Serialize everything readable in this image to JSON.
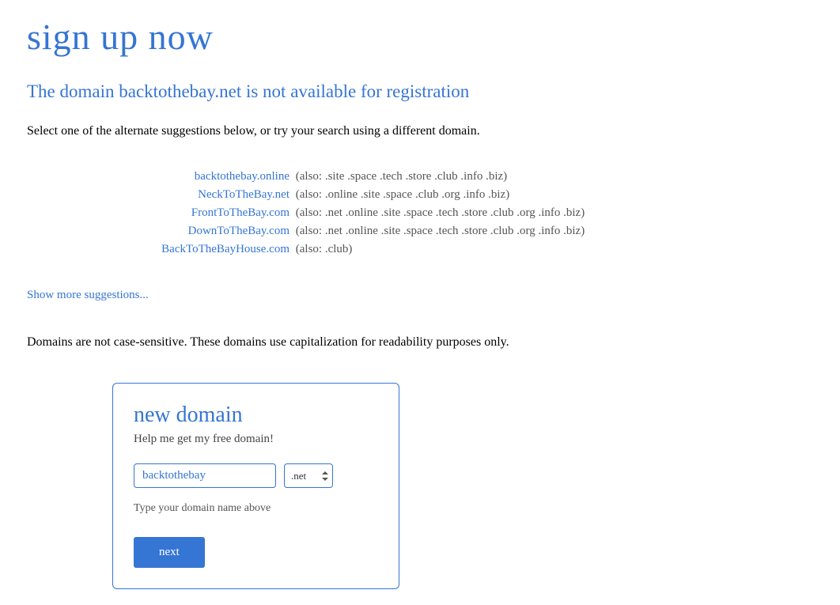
{
  "header": {
    "title": "sign up now",
    "subtitle": "The domain backtothebay.net is not available for registration",
    "instruction": "Select one of the alternate suggestions below, or try your search using a different domain."
  },
  "suggestions": [
    {
      "domain": "backtothebay.online",
      "also": "(also: .site .space .tech .store .club .info .biz)"
    },
    {
      "domain": "NeckToTheBay.net",
      "also": "(also: .online .site .space .club .org .info .biz)"
    },
    {
      "domain": "FrontToTheBay.com",
      "also": "(also: .net .online .site .space .tech .store .club .org .info .biz)"
    },
    {
      "domain": "DownToTheBay.com",
      "also": "(also: .net .online .site .space .tech .store .club .org .info .biz)"
    },
    {
      "domain": "BackToTheBayHouse.com",
      "also": "(also: .club)"
    }
  ],
  "show_more": "Show more suggestions...",
  "note": "Domains are not case-sensitive. These domains use capitalization for readability purposes only.",
  "form": {
    "title": "new domain",
    "subtitle": "Help me get my free domain!",
    "domain_value": "backtothebay",
    "tld_value": ".net",
    "hint": "Type your domain name above",
    "button": "next"
  }
}
